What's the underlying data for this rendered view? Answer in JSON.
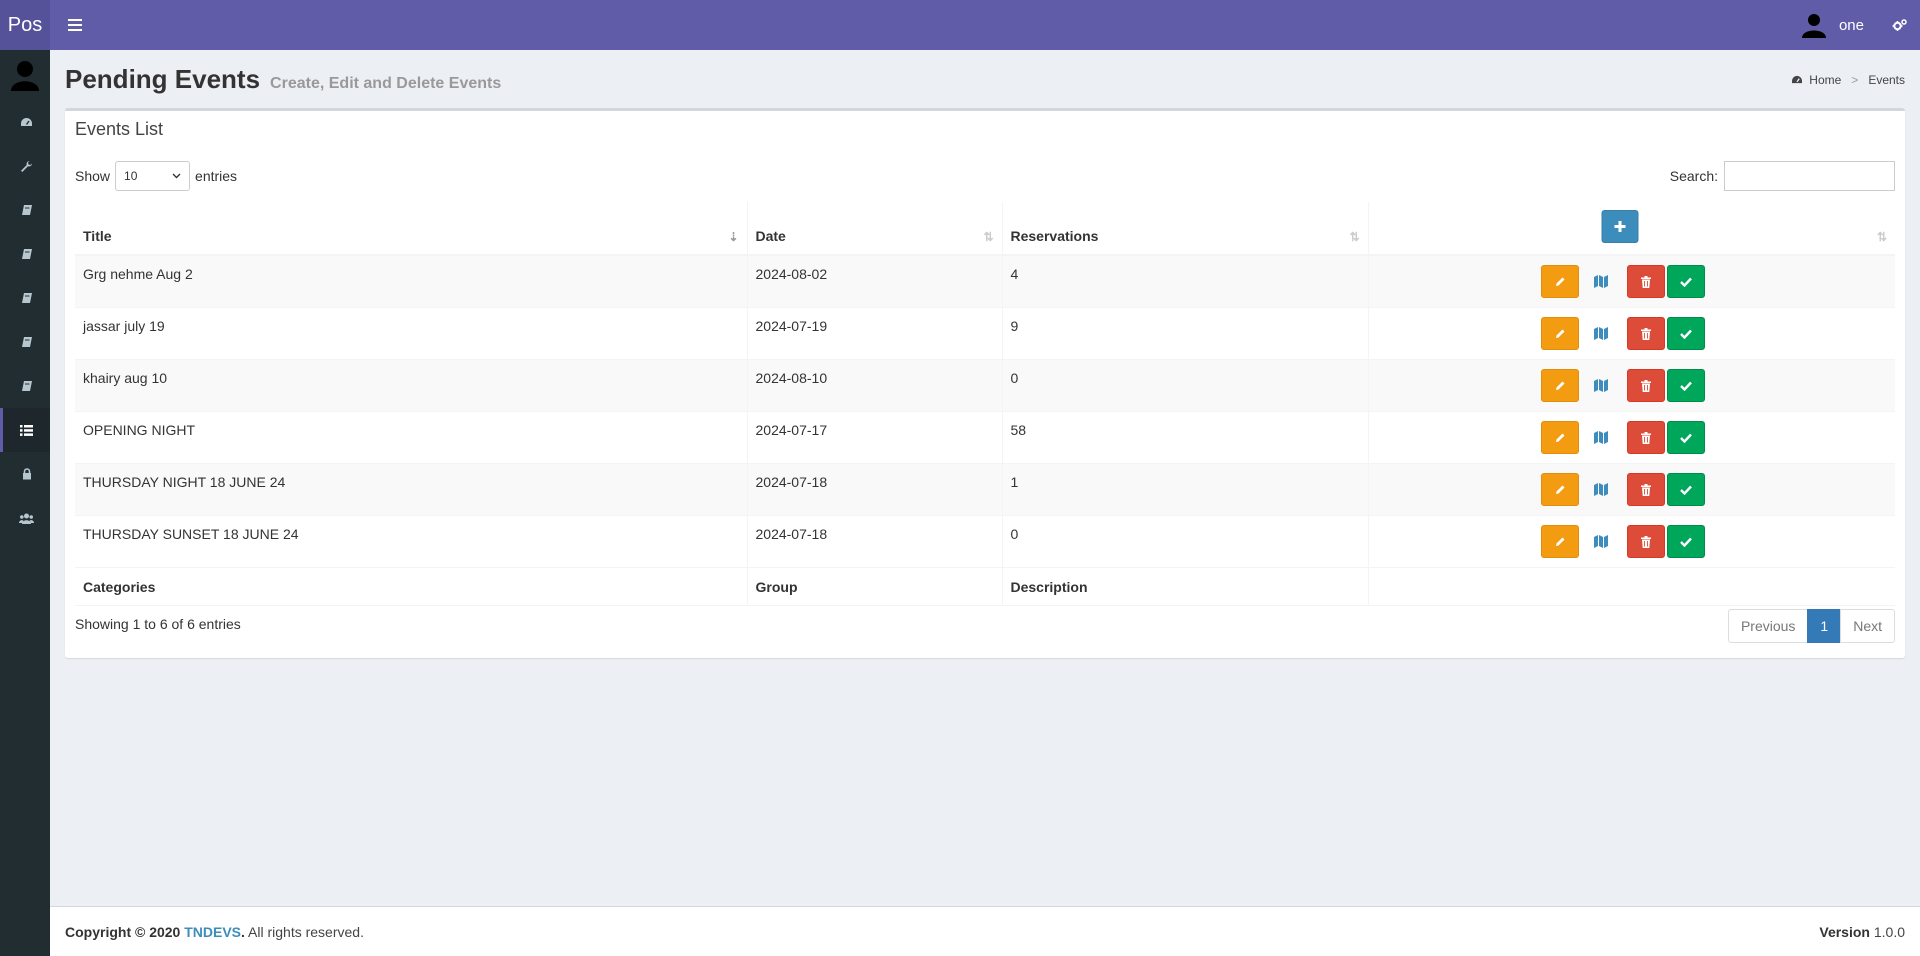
{
  "header": {
    "logo": "Pos",
    "user_name": "one"
  },
  "page": {
    "title": "Pending Events",
    "subtitle": "Create, Edit and Delete Events",
    "breadcrumb": {
      "home": "Home",
      "current": "Events"
    }
  },
  "box": {
    "title": "Events List",
    "length_show": "Show",
    "length_value": "10",
    "length_entries": "entries",
    "search_label": "Search:",
    "search_value": ""
  },
  "table": {
    "columns": [
      "Title",
      "Date",
      "Reservations"
    ],
    "rows": [
      {
        "title": "Grg nehme Aug 2",
        "date": "2024-08-02",
        "reservations": "4"
      },
      {
        "title": "jassar july 19",
        "date": "2024-07-19",
        "reservations": "9"
      },
      {
        "title": "khairy aug 10",
        "date": "2024-08-10",
        "reservations": "0"
      },
      {
        "title": "OPENING NIGHT",
        "date": "2024-07-17",
        "reservations": "58"
      },
      {
        "title": "THURSDAY NIGHT 18 JUNE 24",
        "date": "2024-07-18",
        "reservations": "1"
      },
      {
        "title": "THURSDAY SUNSET 18 JUNE 24",
        "date": "2024-07-18",
        "reservations": "0"
      }
    ],
    "footer": [
      "Categories",
      "Group",
      "Description"
    ]
  },
  "pagination": {
    "info": "Showing 1 to 6 of 6 entries",
    "previous": "Previous",
    "page": "1",
    "next": "Next"
  },
  "footer": {
    "copyright": "Copyright © 2020",
    "company": "TNDEVS",
    "rights": ". All rights reserved.",
    "version_label": "Version",
    "version": "1.0.0"
  },
  "colors": {
    "header": "#605ca8",
    "sidebar": "#222d32",
    "edit": "#f39c12",
    "delete": "#dd4b39",
    "approve": "#00a65a",
    "add": "#3c8dbc",
    "map": "#3c8dbc"
  },
  "icons": {
    "sidebar": [
      "dashboard-icon",
      "wrench-icon",
      "book-icon",
      "book-icon",
      "book-icon",
      "book-icon",
      "book-icon",
      "list-icon",
      "lock-icon",
      "users-icon"
    ],
    "row_actions": [
      "pencil-icon",
      "map-icon",
      "trash-icon",
      "check-icon"
    ]
  }
}
